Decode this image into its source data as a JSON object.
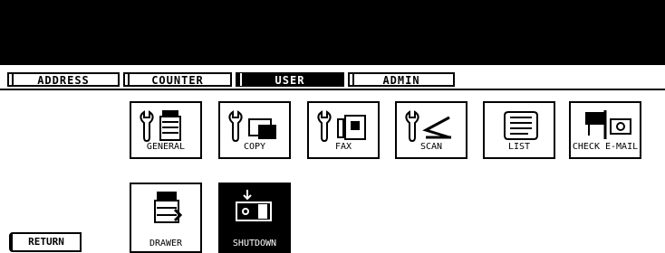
{
  "tabs": [
    {
      "label": "ADDRESS",
      "active": false
    },
    {
      "label": "COUNTER",
      "active": false
    },
    {
      "label": "USER",
      "active": true
    },
    {
      "label": "ADMIN",
      "active": false
    }
  ],
  "menu": {
    "general": {
      "label": "GENERAL",
      "icon": "wrench-copier-icon"
    },
    "copy": {
      "label": "COPY",
      "icon": "wrench-copy-icon"
    },
    "fax": {
      "label": "FAX",
      "icon": "wrench-fax-icon"
    },
    "scan": {
      "label": "SCAN",
      "icon": "wrench-scan-icon"
    },
    "list": {
      "label": "LIST",
      "icon": "list-scroll-icon"
    },
    "check_email": {
      "label": "CHECK E-MAIL",
      "icon": "mailbox-icon"
    },
    "drawer": {
      "label": "DRAWER",
      "icon": "copier-drawer-icon"
    },
    "shutdown": {
      "label": "SHUTDOWN",
      "icon": "shutdown-icon"
    }
  },
  "return_label": "RETURN",
  "colors": {
    "bar": "#000000",
    "background": "#ffffff",
    "active_tab": "#000000"
  }
}
